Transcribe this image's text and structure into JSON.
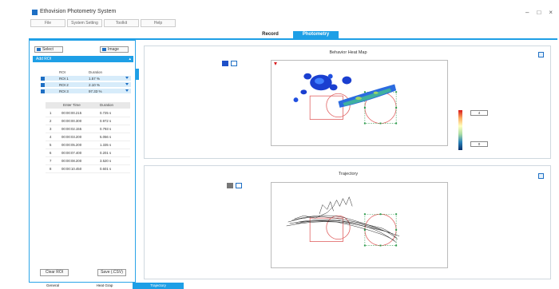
{
  "window": {
    "title": "Ethovision Photometry System",
    "controls": [
      "–",
      "□",
      "×"
    ]
  },
  "menu": [
    "File",
    "System Setting",
    "Toolkit",
    "Help"
  ],
  "main_tabs": [
    {
      "label": "Record",
      "active": false
    },
    {
      "label": "Photometry",
      "active": true
    }
  ],
  "left_panel": {
    "select_label": "Select",
    "image_label": "Image",
    "roi_header": "Add ROI",
    "roi_columns": [
      "ROI",
      "Duration"
    ],
    "roi_rows": [
      {
        "roi": "ROI 1",
        "duration": "1.57 %"
      },
      {
        "roi": "ROI 2",
        "duration": "2.10 %"
      },
      {
        "roi": "ROI 3",
        "duration": "97.33 %"
      }
    ],
    "frame_columns": [
      "Enter Time",
      "Duration"
    ],
    "frame_rows": [
      {
        "n": "1",
        "time": "00:00:00.215",
        "dur": "0.725 s"
      },
      {
        "n": "2",
        "time": "00:00:00.300",
        "dur": "0.972 s"
      },
      {
        "n": "3",
        "time": "00:00:02.155",
        "dur": "0.793 s"
      },
      {
        "n": "4",
        "time": "00:00:03.200",
        "dur": "5.056 s"
      },
      {
        "n": "5",
        "time": "00:00:05.200",
        "dur": "1.335 s"
      },
      {
        "n": "6",
        "time": "00:00:07.400",
        "dur": "0.201 s"
      },
      {
        "n": "7",
        "time": "00:00:08.200",
        "dur": "3.520 s"
      },
      {
        "n": "8",
        "time": "00:00:10.450",
        "dur": "0.601 s"
      }
    ],
    "clear_label": "Clear ROI",
    "save_label": "Save (.CSV)"
  },
  "heatmap_panel": {
    "title": "Behavior Heat Map",
    "colorbar_max": "4",
    "colorbar_min": "0",
    "swatch_colors": [
      "#1e50c8",
      "#ffffff"
    ]
  },
  "trajectory_panel": {
    "title": "Trajectory",
    "swatch_colors": [
      "#777777",
      "#ffffff"
    ]
  },
  "status_tabs": [
    {
      "label": "General",
      "active": false
    },
    {
      "label": "Heat Grap",
      "active": false
    },
    {
      "label": "Trajectory",
      "active": true
    }
  ],
  "colors": {
    "accent": "#1e9fe6",
    "brand": "#1e6fc4"
  }
}
